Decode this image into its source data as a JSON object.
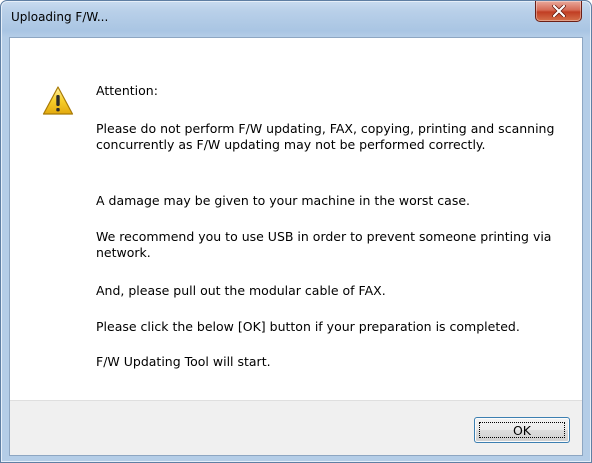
{
  "window": {
    "title": "Uploading F/W...",
    "close_icon": "close-icon"
  },
  "message": {
    "icon": "warning-icon",
    "heading": "Attention:",
    "paragraphs": [
      "Please do not perform F/W updating, FAX, copying, printing and scanning concurrently as F/W updating may not be performed correctly.",
      "A damage may be given to your machine in the worst case.",
      "We recommend you to use USB in order to prevent someone printing via network.",
      "And, please pull out the modular cable of FAX.",
      "Please click the below [OK] button if your preparation is completed.",
      "F/W Updating Tool will start."
    ]
  },
  "buttons": {
    "ok_label": "OK"
  },
  "colors": {
    "title_bar": "#b9d0e9",
    "close_button": "#c13d23",
    "warning_yellow": "#f5c518",
    "footer_background": "#f0f0f0"
  }
}
